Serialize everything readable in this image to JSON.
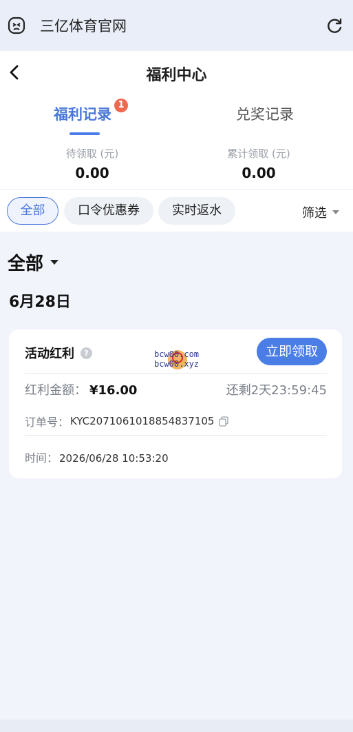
{
  "topbar": {
    "title": "三亿体育官网",
    "app_icon": "ghost-face-icon",
    "refresh_icon": "refresh-icon"
  },
  "header": {
    "title": "福利中心",
    "back_icon": "chevron-left-icon"
  },
  "tabs": [
    {
      "label": "福利记录",
      "active": true,
      "badge": "1"
    },
    {
      "label": "兑奖记录",
      "active": false
    }
  ],
  "stats": {
    "pending_label": "待领取 (元)",
    "pending_value": "0.00",
    "total_label": "累计领取 (元)",
    "total_value": "0.00"
  },
  "filters": {
    "chips": [
      "全部",
      "口令优惠券",
      "实时返水"
    ],
    "filter_label": "筛选"
  },
  "section": {
    "title": "全部",
    "date": "6月28日"
  },
  "card": {
    "title": "活动红利",
    "help_glyph": "?",
    "claim_button": "立即领取",
    "amount_label": "红利金额：",
    "amount_value": "¥16.00",
    "remaining": "还剩2天23:59:45",
    "order_label": "订单号：",
    "order_value": "KYC2071061018854837105",
    "time_label": "时间：",
    "time_value": "2026/06/28 10:53:20"
  },
  "watermark": {
    "line1": "bcw00.com",
    "line2": "bcw00.xyz"
  },
  "colors": {
    "accent": "#4a7ee6",
    "badge": "#ee6a4f",
    "background": "#f1f4fb"
  }
}
